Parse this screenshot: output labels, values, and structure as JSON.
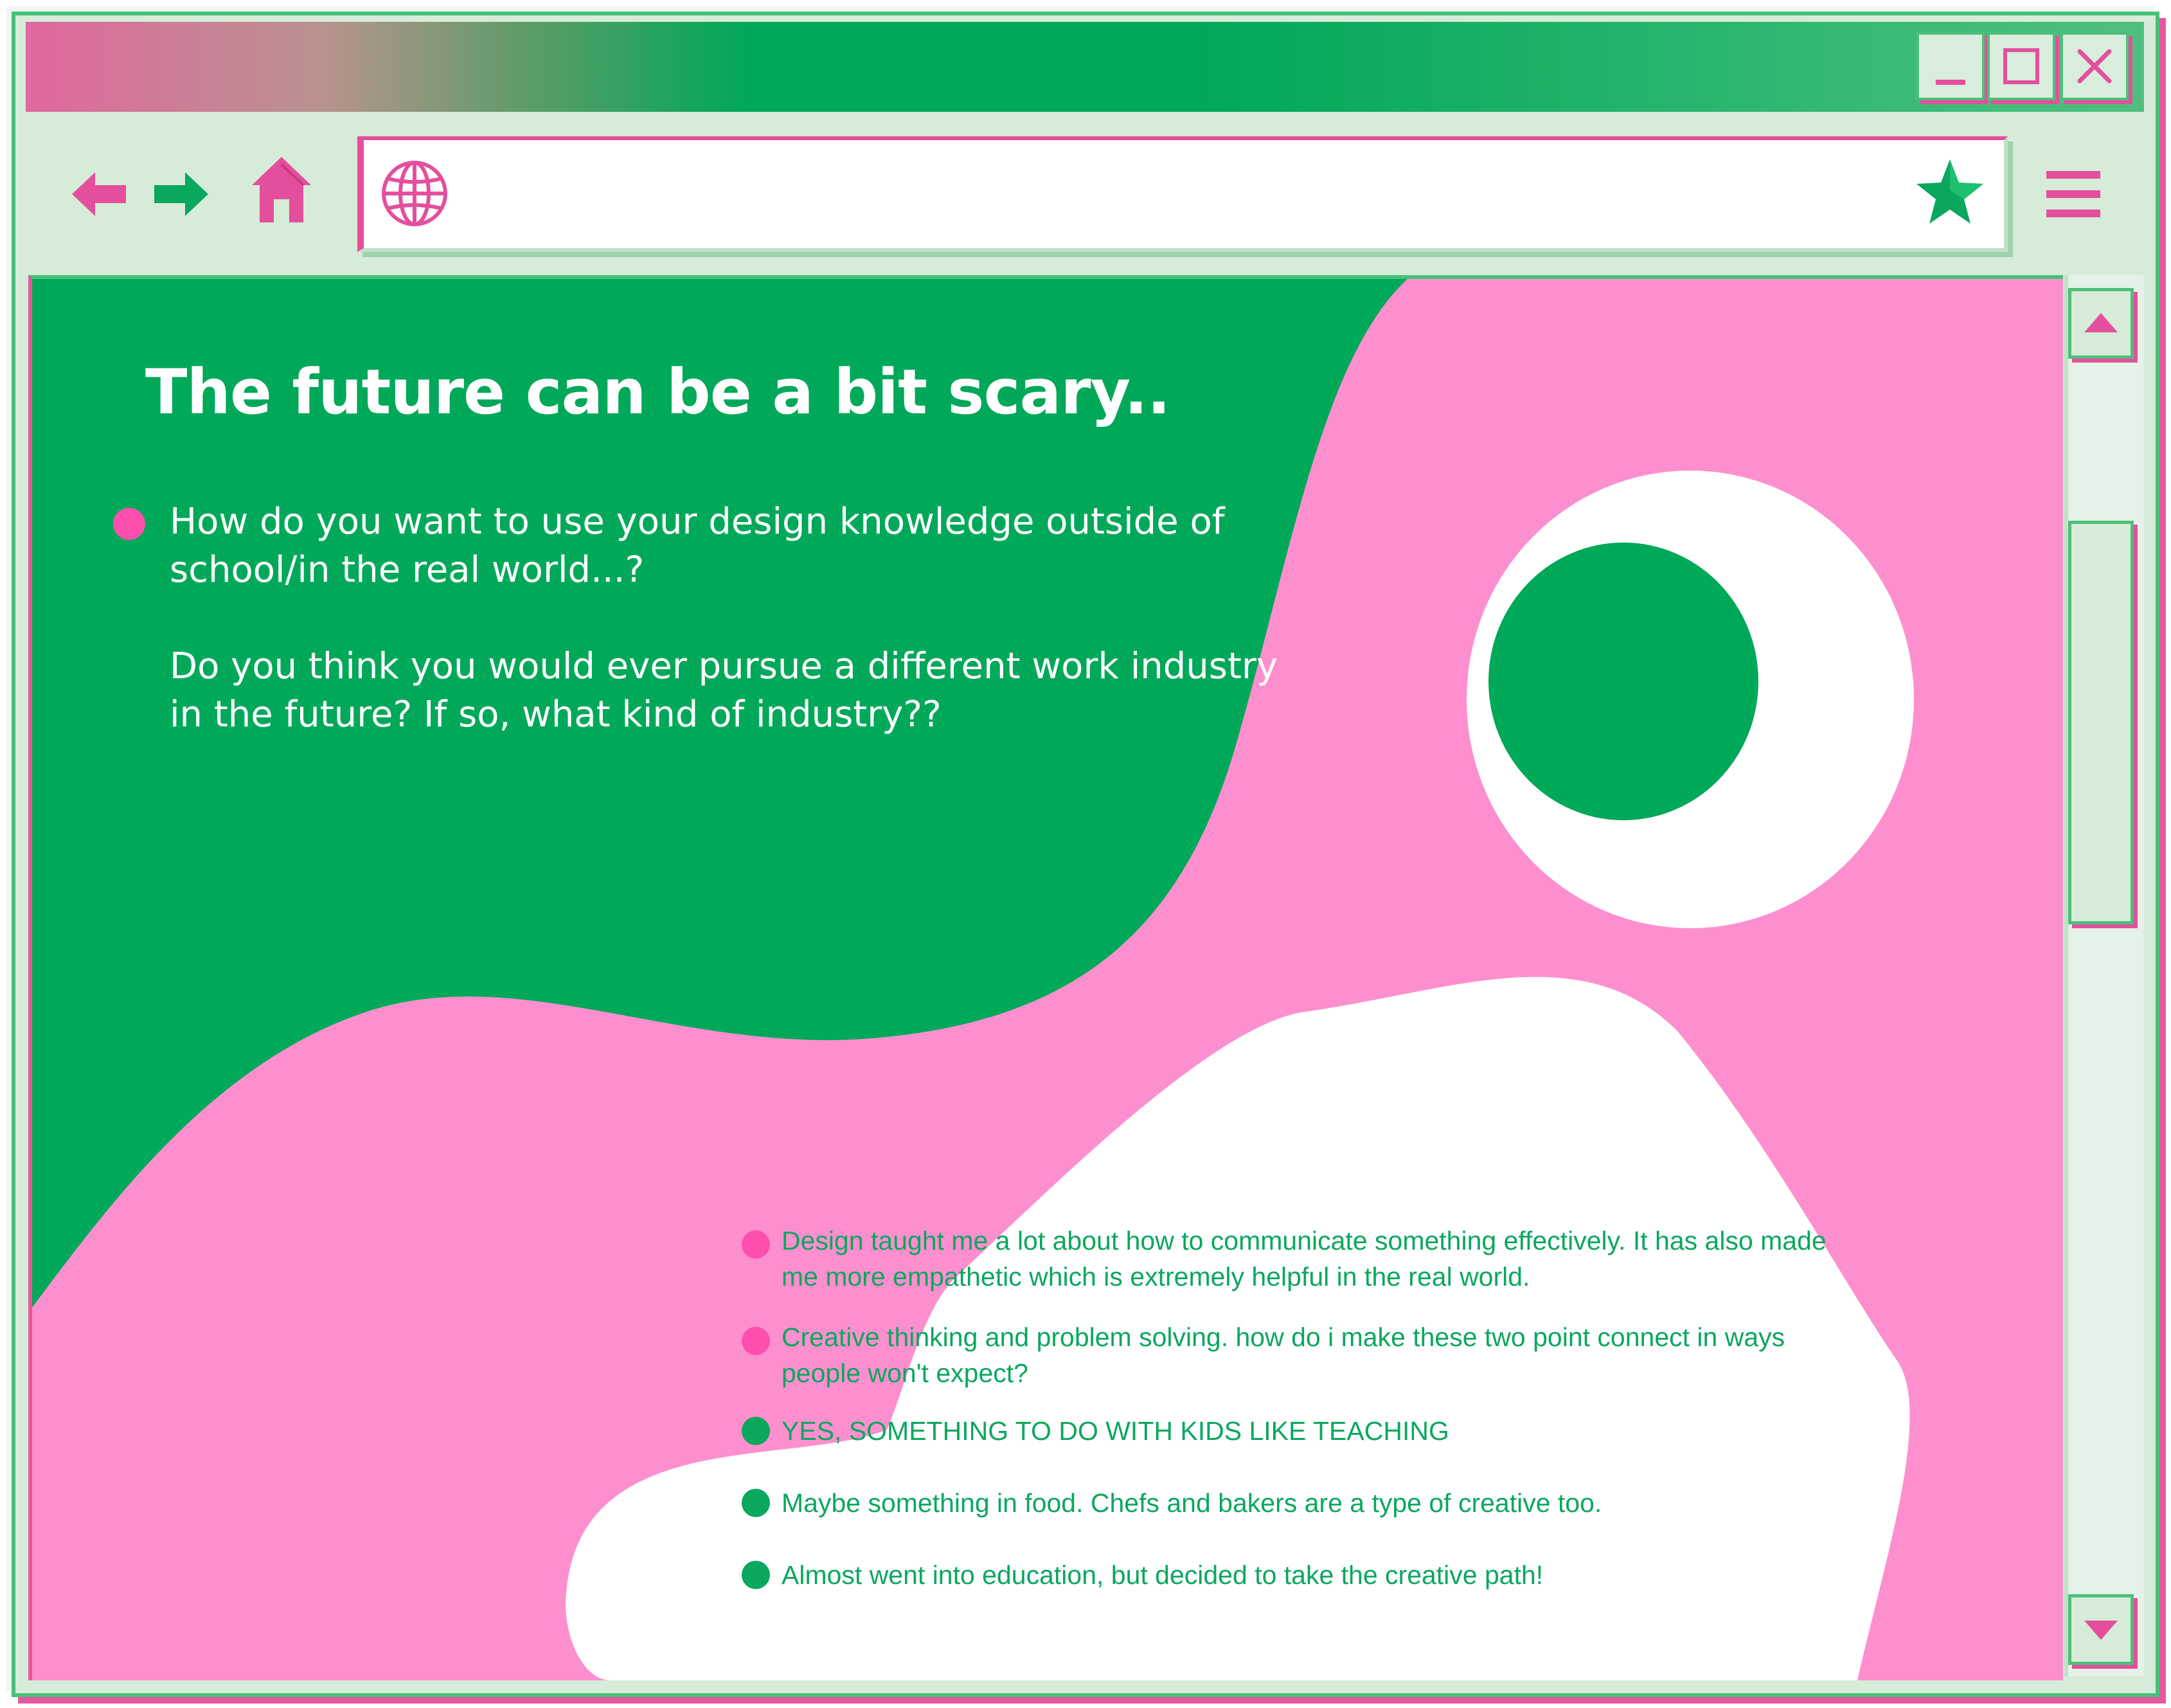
{
  "window": {
    "controls": [
      "minimize-icon",
      "maximize-icon",
      "close-icon"
    ],
    "colors": {
      "pink": "#e44f9d",
      "green": "#00a859",
      "frame": "#d6ecd8"
    }
  },
  "toolbar": {
    "icons": [
      "back-arrow-icon",
      "forward-arrow-icon",
      "home-icon",
      "globe-icon",
      "star-icon",
      "hamburger-menu-icon"
    ],
    "url": ""
  },
  "page": {
    "title": "The future can be a bit scary..",
    "intro": [
      "How do you want to use your design knowledge outside of school/in the real world...?",
      "Do you think you would ever pursue a different work industry in the future? If so, what kind of industry??"
    ],
    "answers": [
      {
        "text": "Design taught me a lot about how to communicate something effectively. It has also made me more empathetic which is extremely helpful in the real world.",
        "dot_color": "#ff4fae"
      },
      {
        "text": "Creative thinking and problem solving. how do i make these two point connect in ways people won't expect?",
        "dot_color": "#ff4fae"
      },
      {
        "text": "YES, SOMETHING TO DO WITH KIDS LIKE TEACHING",
        "dot_color": "#0aa75e"
      },
      {
        "text": "Maybe something in food. Chefs and bakers are a type of creative too.",
        "dot_color": "#0aa75e"
      },
      {
        "text": "Almost went into education, but decided to take the creative path!",
        "dot_color": "#0aa75e"
      }
    ],
    "colors": {
      "background_pink": "#fe8fcf",
      "green_shape": "#00a859",
      "white_shape": "#ffffff"
    }
  },
  "scrollbar": {
    "icons": [
      "scroll-up-icon",
      "scroll-down-icon"
    ]
  }
}
